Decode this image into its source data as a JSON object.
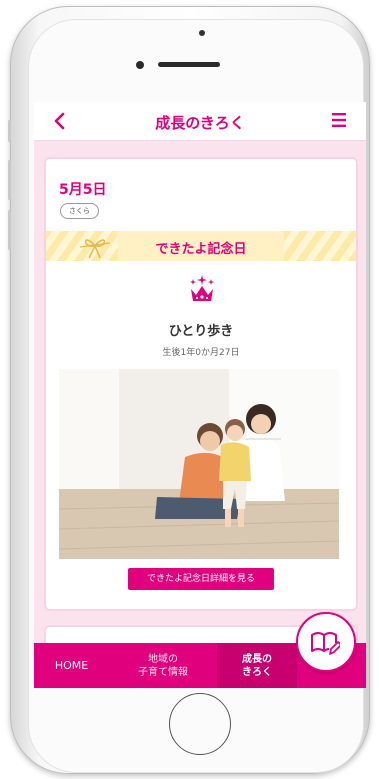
{
  "header": {
    "title": "成長のきろく"
  },
  "record": {
    "date": "5月5日",
    "child_name": "さくら",
    "banner": "できたよ記念日",
    "milestone": "ひとり歩き",
    "age": "生後1年0か月27日",
    "detail_button": "できたよ記念日詳細を見る"
  },
  "nav": {
    "home": "HOME",
    "local_info": "地域の\n子育て情報",
    "growth": "成長の\nきろく"
  },
  "colors": {
    "accent": "#e0007d",
    "background": "#fbe3ee",
    "banner": "#fde9a8"
  },
  "icons": [
    "back-arrow",
    "hamburger-menu",
    "ribbon",
    "crown",
    "book-pencil"
  ]
}
